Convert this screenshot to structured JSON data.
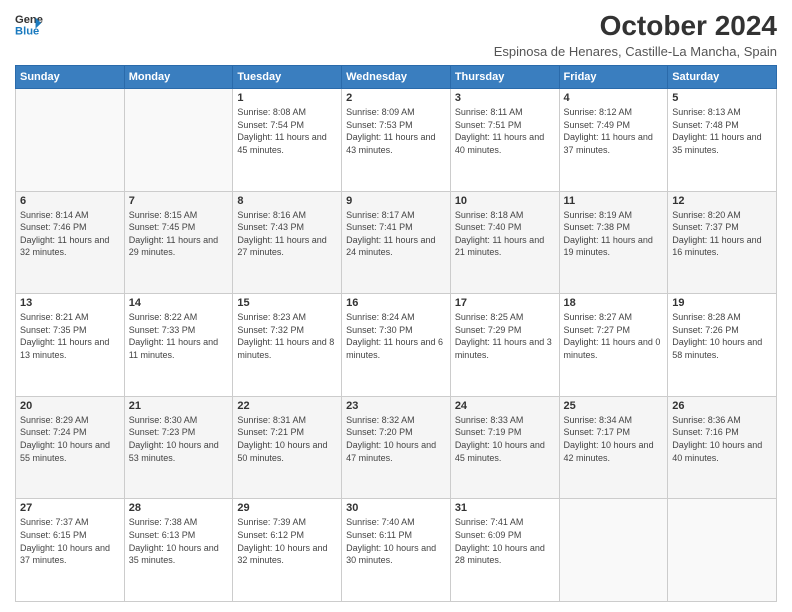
{
  "logo": {
    "line1": "General",
    "line2": "Blue"
  },
  "title": "October 2024",
  "location": "Espinosa de Henares, Castille-La Mancha, Spain",
  "weekdays": [
    "Sunday",
    "Monday",
    "Tuesday",
    "Wednesday",
    "Thursday",
    "Friday",
    "Saturday"
  ],
  "weeks": [
    [
      {
        "day": "",
        "sunrise": "",
        "sunset": "",
        "daylight": ""
      },
      {
        "day": "",
        "sunrise": "",
        "sunset": "",
        "daylight": ""
      },
      {
        "day": "1",
        "sunrise": "Sunrise: 8:08 AM",
        "sunset": "Sunset: 7:54 PM",
        "daylight": "Daylight: 11 hours and 45 minutes."
      },
      {
        "day": "2",
        "sunrise": "Sunrise: 8:09 AM",
        "sunset": "Sunset: 7:53 PM",
        "daylight": "Daylight: 11 hours and 43 minutes."
      },
      {
        "day": "3",
        "sunrise": "Sunrise: 8:11 AM",
        "sunset": "Sunset: 7:51 PM",
        "daylight": "Daylight: 11 hours and 40 minutes."
      },
      {
        "day": "4",
        "sunrise": "Sunrise: 8:12 AM",
        "sunset": "Sunset: 7:49 PM",
        "daylight": "Daylight: 11 hours and 37 minutes."
      },
      {
        "day": "5",
        "sunrise": "Sunrise: 8:13 AM",
        "sunset": "Sunset: 7:48 PM",
        "daylight": "Daylight: 11 hours and 35 minutes."
      }
    ],
    [
      {
        "day": "6",
        "sunrise": "Sunrise: 8:14 AM",
        "sunset": "Sunset: 7:46 PM",
        "daylight": "Daylight: 11 hours and 32 minutes."
      },
      {
        "day": "7",
        "sunrise": "Sunrise: 8:15 AM",
        "sunset": "Sunset: 7:45 PM",
        "daylight": "Daylight: 11 hours and 29 minutes."
      },
      {
        "day": "8",
        "sunrise": "Sunrise: 8:16 AM",
        "sunset": "Sunset: 7:43 PM",
        "daylight": "Daylight: 11 hours and 27 minutes."
      },
      {
        "day": "9",
        "sunrise": "Sunrise: 8:17 AM",
        "sunset": "Sunset: 7:41 PM",
        "daylight": "Daylight: 11 hours and 24 minutes."
      },
      {
        "day": "10",
        "sunrise": "Sunrise: 8:18 AM",
        "sunset": "Sunset: 7:40 PM",
        "daylight": "Daylight: 11 hours and 21 minutes."
      },
      {
        "day": "11",
        "sunrise": "Sunrise: 8:19 AM",
        "sunset": "Sunset: 7:38 PM",
        "daylight": "Daylight: 11 hours and 19 minutes."
      },
      {
        "day": "12",
        "sunrise": "Sunrise: 8:20 AM",
        "sunset": "Sunset: 7:37 PM",
        "daylight": "Daylight: 11 hours and 16 minutes."
      }
    ],
    [
      {
        "day": "13",
        "sunrise": "Sunrise: 8:21 AM",
        "sunset": "Sunset: 7:35 PM",
        "daylight": "Daylight: 11 hours and 13 minutes."
      },
      {
        "day": "14",
        "sunrise": "Sunrise: 8:22 AM",
        "sunset": "Sunset: 7:33 PM",
        "daylight": "Daylight: 11 hours and 11 minutes."
      },
      {
        "day": "15",
        "sunrise": "Sunrise: 8:23 AM",
        "sunset": "Sunset: 7:32 PM",
        "daylight": "Daylight: 11 hours and 8 minutes."
      },
      {
        "day": "16",
        "sunrise": "Sunrise: 8:24 AM",
        "sunset": "Sunset: 7:30 PM",
        "daylight": "Daylight: 11 hours and 6 minutes."
      },
      {
        "day": "17",
        "sunrise": "Sunrise: 8:25 AM",
        "sunset": "Sunset: 7:29 PM",
        "daylight": "Daylight: 11 hours and 3 minutes."
      },
      {
        "day": "18",
        "sunrise": "Sunrise: 8:27 AM",
        "sunset": "Sunset: 7:27 PM",
        "daylight": "Daylight: 11 hours and 0 minutes."
      },
      {
        "day": "19",
        "sunrise": "Sunrise: 8:28 AM",
        "sunset": "Sunset: 7:26 PM",
        "daylight": "Daylight: 10 hours and 58 minutes."
      }
    ],
    [
      {
        "day": "20",
        "sunrise": "Sunrise: 8:29 AM",
        "sunset": "Sunset: 7:24 PM",
        "daylight": "Daylight: 10 hours and 55 minutes."
      },
      {
        "day": "21",
        "sunrise": "Sunrise: 8:30 AM",
        "sunset": "Sunset: 7:23 PM",
        "daylight": "Daylight: 10 hours and 53 minutes."
      },
      {
        "day": "22",
        "sunrise": "Sunrise: 8:31 AM",
        "sunset": "Sunset: 7:21 PM",
        "daylight": "Daylight: 10 hours and 50 minutes."
      },
      {
        "day": "23",
        "sunrise": "Sunrise: 8:32 AM",
        "sunset": "Sunset: 7:20 PM",
        "daylight": "Daylight: 10 hours and 47 minutes."
      },
      {
        "day": "24",
        "sunrise": "Sunrise: 8:33 AM",
        "sunset": "Sunset: 7:19 PM",
        "daylight": "Daylight: 10 hours and 45 minutes."
      },
      {
        "day": "25",
        "sunrise": "Sunrise: 8:34 AM",
        "sunset": "Sunset: 7:17 PM",
        "daylight": "Daylight: 10 hours and 42 minutes."
      },
      {
        "day": "26",
        "sunrise": "Sunrise: 8:36 AM",
        "sunset": "Sunset: 7:16 PM",
        "daylight": "Daylight: 10 hours and 40 minutes."
      }
    ],
    [
      {
        "day": "27",
        "sunrise": "Sunrise: 7:37 AM",
        "sunset": "Sunset: 6:15 PM",
        "daylight": "Daylight: 10 hours and 37 minutes."
      },
      {
        "day": "28",
        "sunrise": "Sunrise: 7:38 AM",
        "sunset": "Sunset: 6:13 PM",
        "daylight": "Daylight: 10 hours and 35 minutes."
      },
      {
        "day": "29",
        "sunrise": "Sunrise: 7:39 AM",
        "sunset": "Sunset: 6:12 PM",
        "daylight": "Daylight: 10 hours and 32 minutes."
      },
      {
        "day": "30",
        "sunrise": "Sunrise: 7:40 AM",
        "sunset": "Sunset: 6:11 PM",
        "daylight": "Daylight: 10 hours and 30 minutes."
      },
      {
        "day": "31",
        "sunrise": "Sunrise: 7:41 AM",
        "sunset": "Sunset: 6:09 PM",
        "daylight": "Daylight: 10 hours and 28 minutes."
      },
      {
        "day": "",
        "sunrise": "",
        "sunset": "",
        "daylight": ""
      },
      {
        "day": "",
        "sunrise": "",
        "sunset": "",
        "daylight": ""
      }
    ]
  ]
}
